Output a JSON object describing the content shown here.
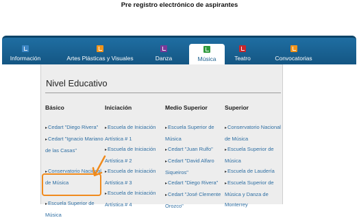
{
  "page_title": "Pre registro electrónico de aspirantes",
  "nav": [
    {
      "label": "Información",
      "icon": "info-icon",
      "color": "#3d86c4",
      "active": false
    },
    {
      "label": "Artes Plásticas y Visuales",
      "icon": "palette-icon",
      "color": "#f0941c",
      "active": false
    },
    {
      "label": "Danza",
      "icon": "dance-icon",
      "color": "#7a3a99",
      "active": false
    },
    {
      "label": "Música",
      "icon": "music-icon",
      "color": "#2f9a3c",
      "active": true
    },
    {
      "label": "Teatro",
      "icon": "theater-icon",
      "color": "#c7262c",
      "active": false
    },
    {
      "label": "Convocatorias",
      "icon": "calendar-icon",
      "color": "#f0941c",
      "active": false
    }
  ],
  "panel": {
    "title": "Nivel Educativo",
    "columns": [
      {
        "header": "Básico",
        "items": [
          "Cedart \"Diego Rivera\"",
          "Cedart \"Ignacio Mariano de las Casas\"",
          "Conservatorio Nacional de Música",
          "Escuela Superior de Música"
        ]
      },
      {
        "header": "Iniciación",
        "items": [
          "Escuela de Iniciación Artística # 1",
          "Escuela de Iniciación Artística # 2",
          "Escuela de Iniciación Artística # 3",
          "Escuela de Iniciación Artística # 4"
        ]
      },
      {
        "header": "Medio Superior",
        "items": [
          "Escuela Superior de Música",
          "Cedart \"Juan Rulfo\"",
          "Cedart \"David Alfaro Siqueiros\"",
          "Cedart \"Diego Rivera\"",
          "Cedart \"José Clemente Orozco\""
        ]
      },
      {
        "header": "Superior",
        "items": [
          "Conservatorio Nacional de Música",
          "Escuela Superior de Música",
          "Escuela de Laudería",
          "Escuela Superior de Música y Danza de Monterrey"
        ]
      }
    ]
  },
  "highlight_color": "#f08a1c"
}
